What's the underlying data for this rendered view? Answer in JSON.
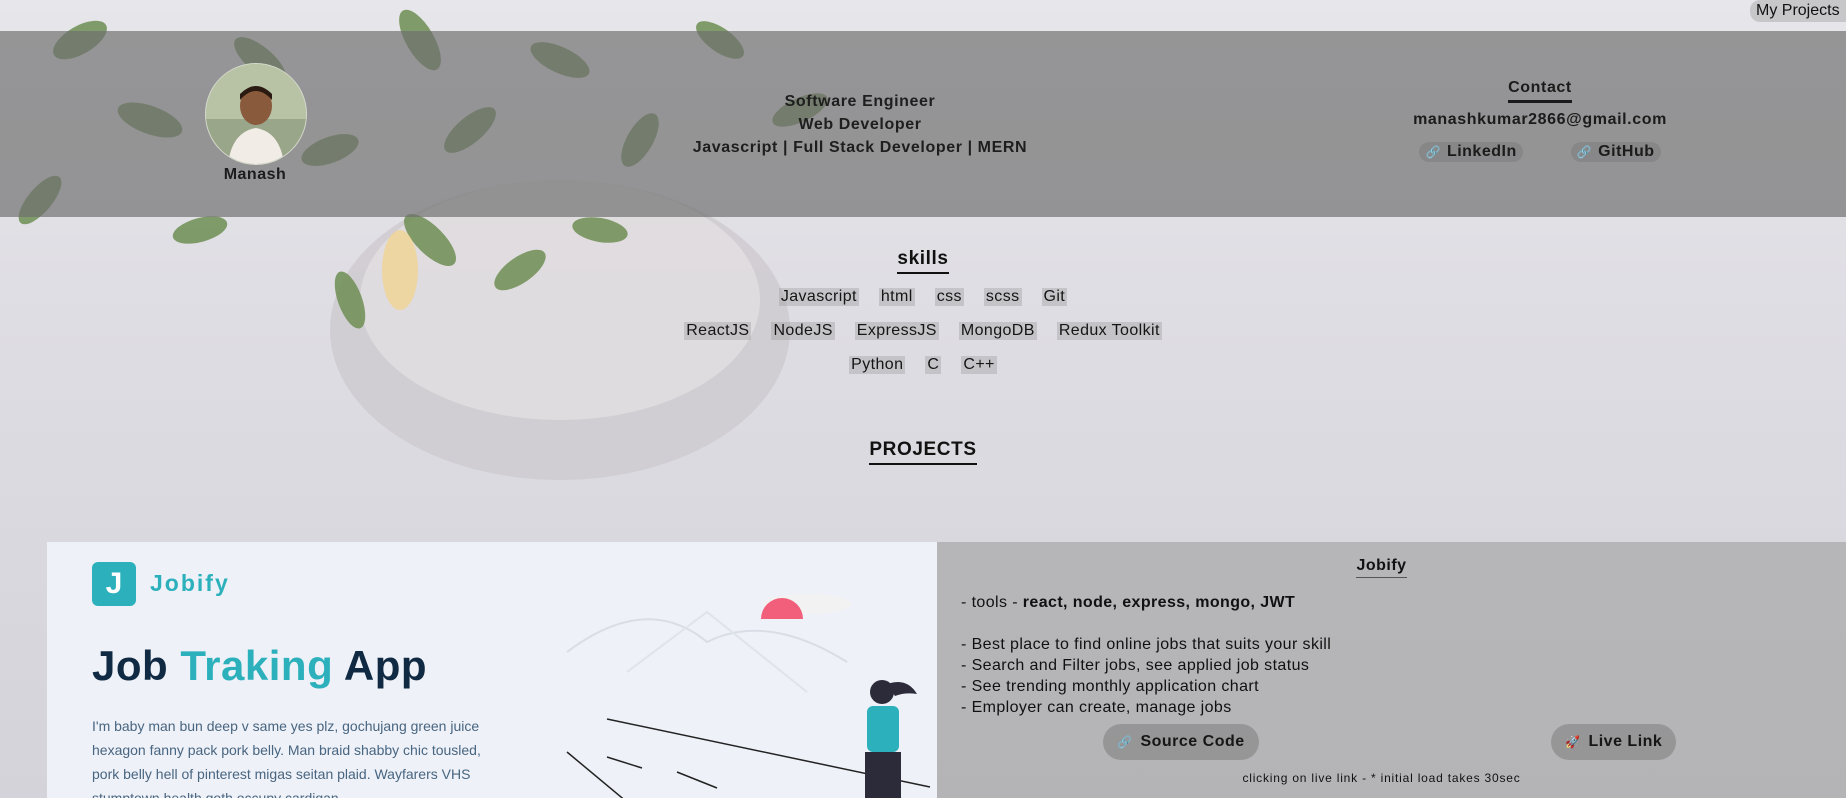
{
  "nav": {
    "my_projects": "My Projects"
  },
  "profile": {
    "name": "Manash"
  },
  "roles": [
    "Software Engineer",
    "Web Developer",
    "Javascript | Full Stack Developer | MERN"
  ],
  "contact": {
    "title": "Contact",
    "email": "manashkumar2866@gmail.com",
    "links": [
      "LinkedIn",
      "GitHub"
    ]
  },
  "skills": {
    "title": "skills",
    "rows": [
      [
        "Javascript",
        "html",
        "css",
        "scss",
        "Git"
      ],
      [
        "ReactJS",
        "NodeJS",
        "ExpressJS",
        "MongoDB",
        "Redux Toolkit"
      ],
      [
        "Python",
        "C",
        "C++"
      ]
    ]
  },
  "projects": {
    "title": "PROJECTS",
    "items": [
      {
        "name": "Jobify",
        "screenshot": {
          "logo_letter": "J",
          "logo_text": "Jobify",
          "hero_title_1": "Job",
          "hero_title_2": "Traking",
          "hero_title_3": "App",
          "hero_text": "I'm baby man bun deep v same yes plz, gochujang green juice hexagon fanny pack pork belly. Man braid shabby chic tousled, pork belly hell of pinterest migas seitan plaid. Wayfarers VHS stumptown health goth occupy cardigan."
        },
        "tools_prefix": "- tools - ",
        "tools": "react, node, express, mongo, JWT",
        "features": [
          "- Best place to find online jobs that suits your skill",
          "- Search and Filter jobs, see applied job status",
          "- See trending monthly application chart",
          "- Employer can create, manage jobs"
        ],
        "source_label": "Source Code",
        "live_label": "Live Link",
        "note": "clicking on live link - * initial load takes 30sec"
      }
    ]
  },
  "colors": {
    "brand": "#2cb1bc",
    "heading_dark": "#102a43",
    "accent_red": "#f25f7a"
  }
}
